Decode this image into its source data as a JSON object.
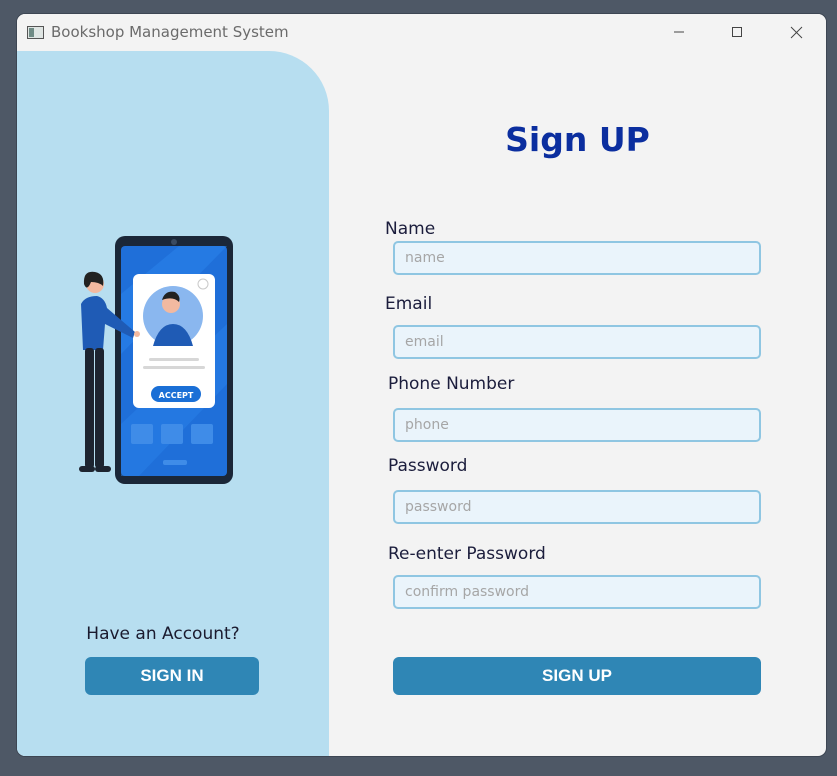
{
  "window": {
    "title": "Bookshop Management System",
    "controls": [
      "minimize-icon",
      "maximize-icon",
      "close-icon"
    ]
  },
  "left_panel": {
    "illustration_button_text": "ACCEPT",
    "have_account_text": "Have an Account?",
    "sign_in_label": "SIGN IN"
  },
  "form": {
    "title": "Sign UP",
    "fields": [
      {
        "label": "Name",
        "placeholder": "name",
        "value": ""
      },
      {
        "label": "Email",
        "placeholder": "email",
        "value": ""
      },
      {
        "label": "Phone Number",
        "placeholder": "phone",
        "value": ""
      },
      {
        "label": "Password",
        "placeholder": "password",
        "value": ""
      },
      {
        "label": "Re-enter Password",
        "placeholder": "confirm password",
        "value": ""
      }
    ],
    "sign_up_label": "SIGN UP"
  },
  "colors": {
    "accent": "#2f86b5",
    "title": "#0b2e9f",
    "left_panel_bg": "#b7def0",
    "input_bg": "#eaf4fb",
    "input_border": "#8fc6e2"
  }
}
